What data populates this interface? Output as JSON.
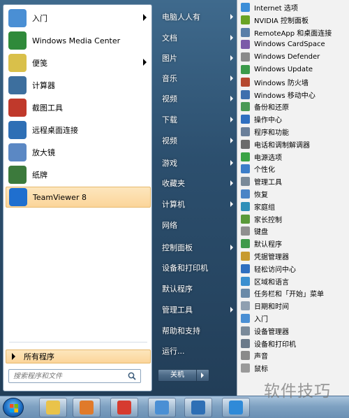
{
  "left_pane": {
    "items": [
      {
        "label": "入门",
        "icon": "getting-started-icon",
        "color": "#4a8fd4",
        "has_arrow": true
      },
      {
        "label": "Windows Media Center",
        "icon": "media-center-icon",
        "color": "#2f8a3a",
        "has_arrow": false
      },
      {
        "label": "便笺",
        "icon": "sticky-notes-icon",
        "color": "#d9c04a",
        "has_arrow": true
      },
      {
        "label": "计算器",
        "icon": "calculator-icon",
        "color": "#3d6f9e",
        "has_arrow": false
      },
      {
        "label": "截图工具",
        "icon": "snipping-tool-icon",
        "color": "#c0392b",
        "has_arrow": false
      },
      {
        "label": "远程桌面连接",
        "icon": "remote-desktop-icon",
        "color": "#2e6fb5",
        "has_arrow": false
      },
      {
        "label": "放大镜",
        "icon": "magnifier-icon",
        "color": "#5b88c4",
        "has_arrow": false
      },
      {
        "label": "纸牌",
        "icon": "solitaire-icon",
        "color": "#3c7a3c",
        "has_arrow": false
      },
      {
        "label": "TeamViewer 8",
        "icon": "teamviewer-icon",
        "color": "#1f6fcf",
        "has_arrow": false
      }
    ],
    "all_programs": "所有程序",
    "search_placeholder": "搜索程序和文件"
  },
  "middle_pane": {
    "items": [
      {
        "label": "电脑人人有",
        "has_arrow": true
      },
      {
        "label": "文档",
        "has_arrow": true
      },
      {
        "label": "图片",
        "has_arrow": true
      },
      {
        "label": "音乐",
        "has_arrow": true
      },
      {
        "label": "视频",
        "has_arrow": true
      },
      {
        "label": "下载",
        "has_arrow": true
      },
      {
        "label": "视频",
        "has_arrow": true
      },
      {
        "label": "游戏",
        "has_arrow": true
      },
      {
        "label": "收藏夹",
        "has_arrow": true
      },
      {
        "label": "计算机",
        "has_arrow": true
      },
      {
        "label": "网络",
        "has_arrow": false
      },
      {
        "label": "控制面板",
        "has_arrow": true
      },
      {
        "label": "设备和打印机",
        "has_arrow": false
      },
      {
        "label": "默认程序",
        "has_arrow": false
      },
      {
        "label": "管理工具",
        "has_arrow": true
      },
      {
        "label": "帮助和支持",
        "has_arrow": false
      },
      {
        "label": "运行...",
        "has_arrow": false
      }
    ],
    "shutdown": "关机"
  },
  "control_panel_menu": {
    "items": [
      {
        "label": "Internet 选项",
        "icon": "internet-options-icon",
        "color": "#3b8ed8"
      },
      {
        "label": "NVIDIA 控制面板",
        "icon": "nvidia-icon",
        "color": "#6aa324"
      },
      {
        "label": "RemoteApp 和桌面连接",
        "icon": "remoteapp-icon",
        "color": "#5a7fa8"
      },
      {
        "label": "Windows CardSpace",
        "icon": "cardspace-icon",
        "color": "#7b5aa8"
      },
      {
        "label": "Windows Defender",
        "icon": "defender-icon",
        "color": "#8a8a8a"
      },
      {
        "label": "Windows Update",
        "icon": "windows-update-icon",
        "color": "#3a9a4a"
      },
      {
        "label": "Windows 防火墙",
        "icon": "firewall-icon",
        "color": "#b5482f"
      },
      {
        "label": "Windows 移动中心",
        "icon": "mobility-center-icon",
        "color": "#3f6fae"
      },
      {
        "label": "备份和还原",
        "icon": "backup-icon",
        "color": "#4a9a55"
      },
      {
        "label": "操作中心",
        "icon": "action-center-icon",
        "color": "#2f6fc0"
      },
      {
        "label": "程序和功能",
        "icon": "programs-features-icon",
        "color": "#6a7f9a"
      },
      {
        "label": "电话和调制解调器",
        "icon": "phone-modem-icon",
        "color": "#6b6b6b"
      },
      {
        "label": "电源选项",
        "icon": "power-options-icon",
        "color": "#3aa345"
      },
      {
        "label": "个性化",
        "icon": "personalization-icon",
        "color": "#3c7ec9"
      },
      {
        "label": "管理工具",
        "icon": "admin-tools-icon",
        "color": "#7a8a99"
      },
      {
        "label": "恢复",
        "icon": "recovery-icon",
        "color": "#4a84c6"
      },
      {
        "label": "家庭组",
        "icon": "homegroup-icon",
        "color": "#2e8fb8"
      },
      {
        "label": "家长控制",
        "icon": "parental-controls-icon",
        "color": "#5a9a3a"
      },
      {
        "label": "键盘",
        "icon": "keyboard-icon",
        "color": "#8f8f8f"
      },
      {
        "label": "默认程序",
        "icon": "default-programs-icon",
        "color": "#3f9a4a"
      },
      {
        "label": "凭据管理器",
        "icon": "credential-manager-icon",
        "color": "#c79a2f"
      },
      {
        "label": "轻松访问中心",
        "icon": "ease-of-access-icon",
        "color": "#2f6fc0"
      },
      {
        "label": "区域和语言",
        "icon": "region-language-icon",
        "color": "#3a8fd0"
      },
      {
        "label": "任务栏和「开始」菜单",
        "icon": "taskbar-start-icon",
        "color": "#6a8aa8"
      },
      {
        "label": "日期和时间",
        "icon": "date-time-icon",
        "color": "#8f9fb0"
      },
      {
        "label": "入门",
        "icon": "getting-started-icon",
        "color": "#4a8fd4"
      },
      {
        "label": "设备管理器",
        "icon": "device-manager-icon",
        "color": "#7a8a9a"
      },
      {
        "label": "设备和打印机",
        "icon": "devices-printers-icon",
        "color": "#6a7a8a"
      },
      {
        "label": "声音",
        "icon": "sound-icon",
        "color": "#8a8a8a"
      },
      {
        "label": "鼠标",
        "icon": "mouse-icon",
        "color": "#9a9a9a"
      }
    ]
  },
  "taskbar": {
    "buttons": [
      {
        "icon": "explorer-icon",
        "color": "#e9c34a"
      },
      {
        "icon": "media-player-icon",
        "color": "#e07a2a"
      },
      {
        "icon": "chrome-icon",
        "color": "#d63b2f"
      },
      {
        "icon": "paint-icon",
        "color": "#4a8fd4"
      },
      {
        "icon": "remote-desktop-icon",
        "color": "#2e6fb5"
      },
      {
        "icon": "internet-explorer-icon",
        "color": "#2f8ad8"
      }
    ]
  },
  "watermark": "软件技巧"
}
